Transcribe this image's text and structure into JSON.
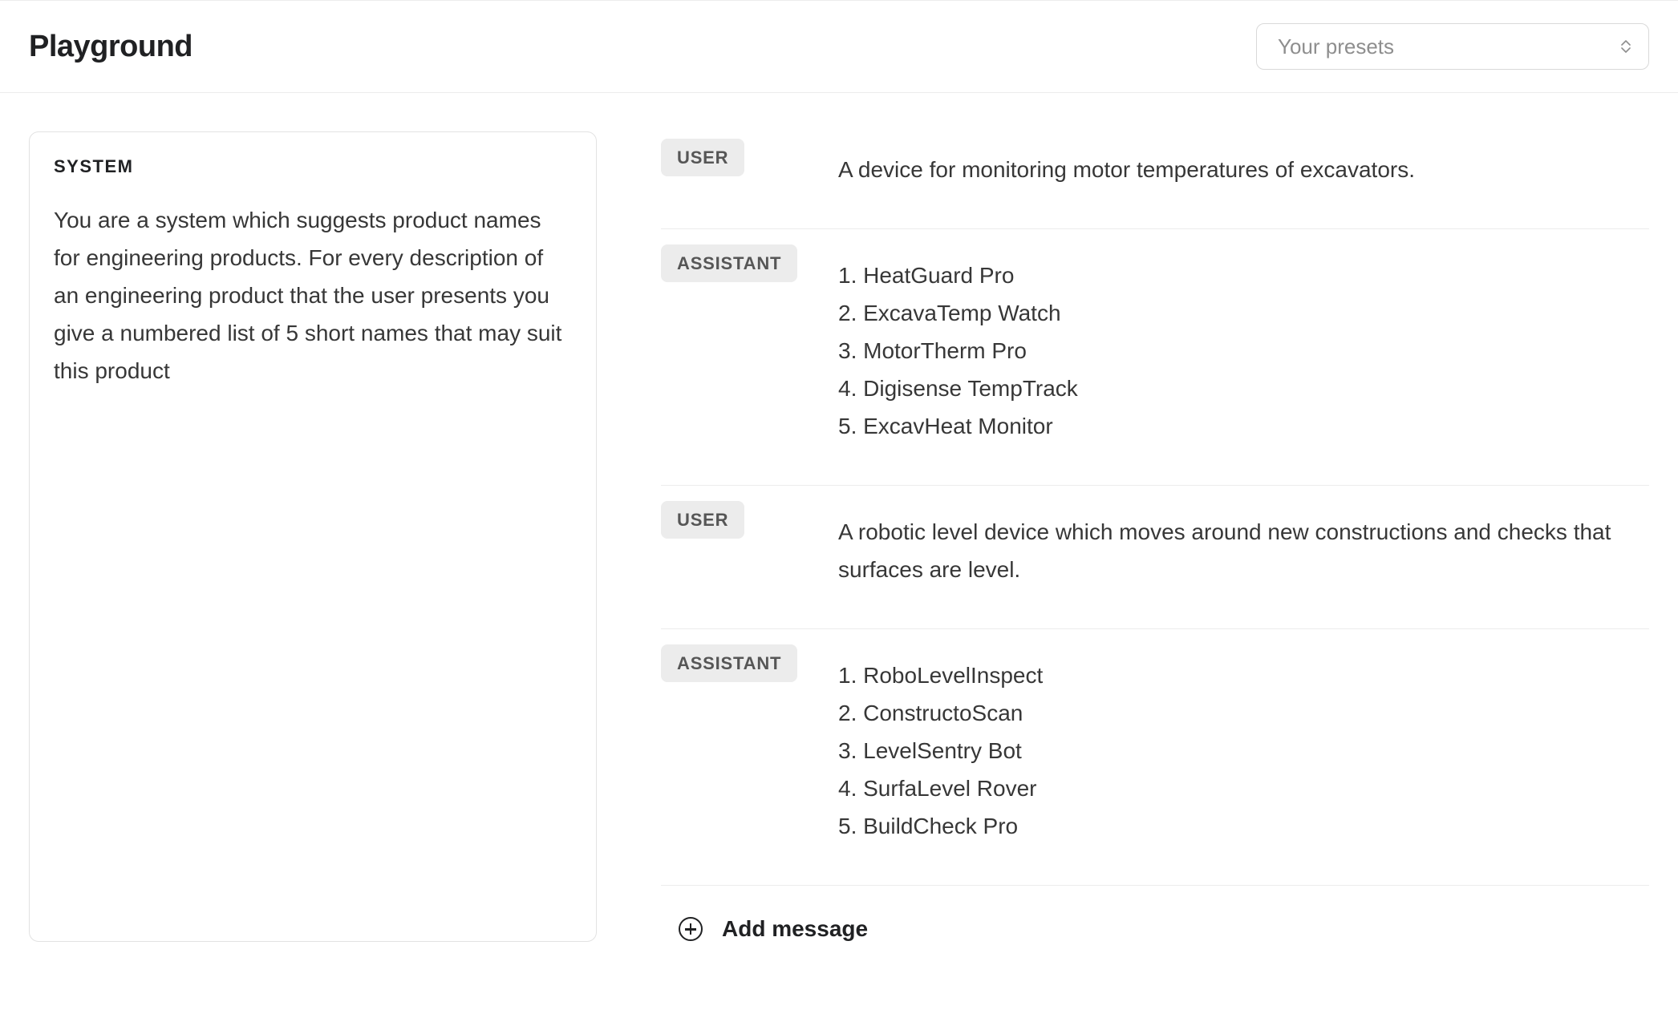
{
  "header": {
    "title": "Playground",
    "preset_placeholder": "Your presets"
  },
  "system": {
    "label": "SYSTEM",
    "text": "You are a system which suggests product names for engineering products. For every description of an engineering product that the user presents you give a numbered list of 5 short names that may suit this product"
  },
  "roles": {
    "user": "USER",
    "assistant": "ASSISTANT"
  },
  "messages": [
    {
      "role": "user",
      "content": "A device for monitoring motor temperatures of excavators."
    },
    {
      "role": "assistant",
      "content": "1. HeatGuard Pro\n2. ExcavaTemp Watch\n3. MotorTherm Pro\n4. Digisense TempTrack\n5. ExcavHeat Monitor"
    },
    {
      "role": "user",
      "content": "A robotic level device which moves around new constructions and checks that surfaces are level."
    },
    {
      "role": "assistant",
      "content": "1. RoboLevelInspect\n2. ConstructoScan\n3. LevelSentry Bot\n4. SurfaLevel Rover\n5. BuildCheck Pro"
    }
  ],
  "add_message_label": "Add message"
}
